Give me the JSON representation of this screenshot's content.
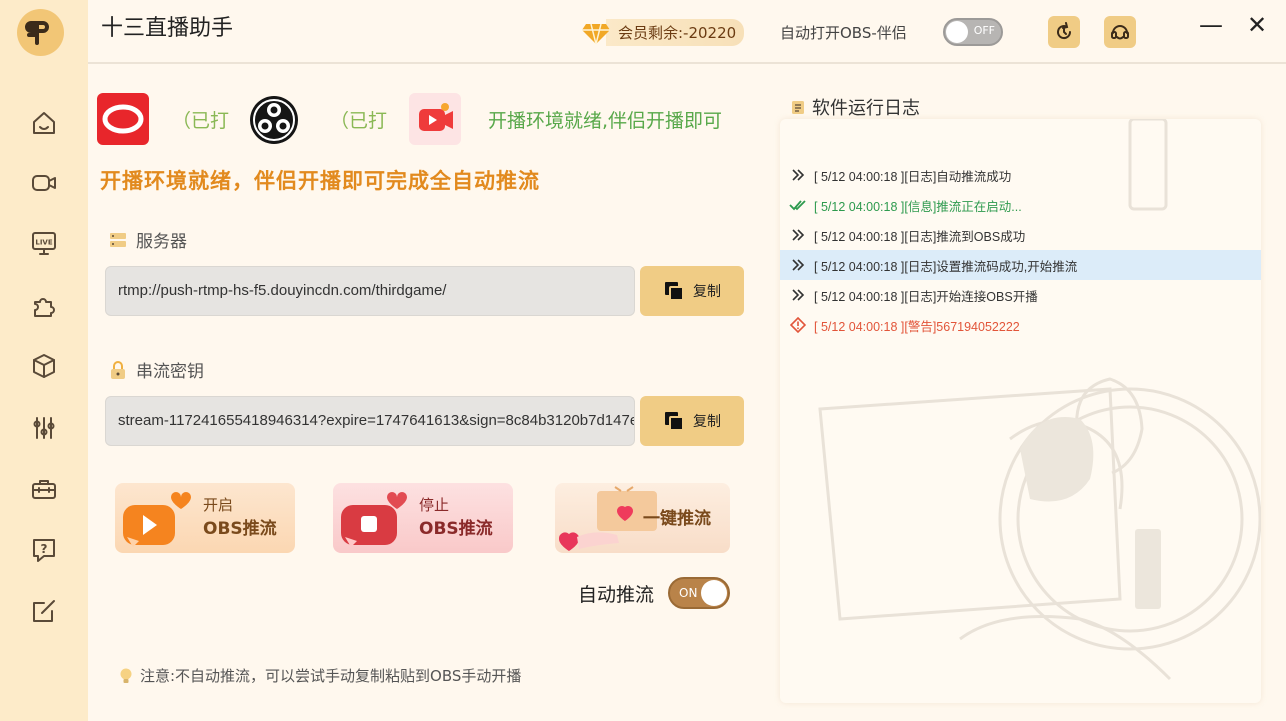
{
  "app": {
    "title": "十三直播助手",
    "vip_text": "会员剩余:-20220",
    "obs_label": "自动打开OBS-伴侣",
    "obs_toggle": "OFF",
    "minimize": "—",
    "close": "✕"
  },
  "sidebar": {
    "items": [
      {
        "name": "home-icon"
      },
      {
        "name": "camera-icon"
      },
      {
        "name": "live-icon",
        "text": "LIVE"
      },
      {
        "name": "puzzle-icon"
      },
      {
        "name": "box-icon"
      },
      {
        "name": "sliders-icon"
      },
      {
        "name": "toolbox-icon"
      },
      {
        "name": "help-icon",
        "text": "?"
      },
      {
        "name": "edit-icon"
      }
    ]
  },
  "platforms": {
    "douyin_status": "（已打",
    "obs_status": "（已打",
    "companion_status": "开播环境就绪,伴侣开播即可"
  },
  "banner": "开播环境就绪，伴侣开播即可完成全自动推流",
  "server": {
    "label": "服务器",
    "value": "rtmp://push-rtmp-hs-f5.douyincdn.com/thirdgame/",
    "copy": "复制"
  },
  "stream_key": {
    "label": "串流密钥",
    "value": "stream-117241655418946314?expire=1747641613&sign=8c84b3120b7d147e",
    "copy": "复制"
  },
  "actions": {
    "start_line1": "开启",
    "start_line2": "OBS推流",
    "stop_line1": "停止",
    "stop_line2": "OBS推流",
    "one_key": "一键推流"
  },
  "auto_push": {
    "label": "自动推流",
    "toggle": "ON"
  },
  "note": "注意:不自动推流，可以尝试手动复制粘贴到OBS手动开播",
  "log": {
    "title": "软件运行日志",
    "entries": [
      {
        "text": "[ 5/12 04:00:18 ][日志]自动推流成功",
        "type": "log",
        "color": "#333333"
      },
      {
        "text": "[ 5/12 04:00:18 ][信息]推流正在启动...",
        "type": "info",
        "color": "#2e9a4e"
      },
      {
        "text": "[ 5/12 04:00:18 ][日志]推流到OBS成功",
        "type": "log",
        "color": "#333333"
      },
      {
        "text": "[ 5/12 04:00:18 ][日志]设置推流码成功,开始推流",
        "type": "log",
        "color": "#333333"
      },
      {
        "text": "[ 5/12 04:00:18 ][日志]开始连接OBS开播",
        "type": "log",
        "color": "#333333"
      },
      {
        "text": "[ 5/12 04:00:18 ][警告]567194052222",
        "type": "warn",
        "color": "#e2553a"
      }
    ]
  },
  "colors": {
    "accent": "#f0cc85",
    "sidebar": "#fdebc9",
    "banner": "#e28a1e",
    "success": "#2e9a4e",
    "warning": "#e2553a"
  }
}
